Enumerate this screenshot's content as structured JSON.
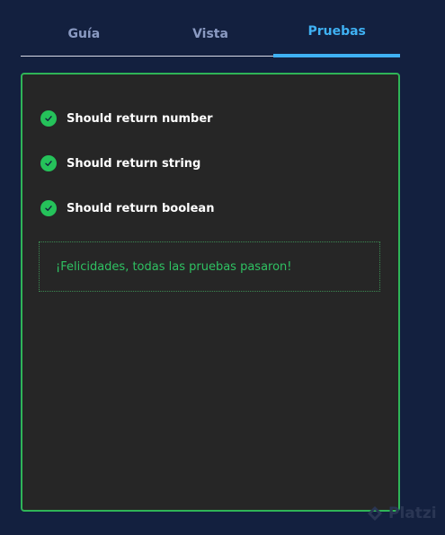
{
  "tabs": [
    {
      "label": "Guía",
      "active": false
    },
    {
      "label": "Vista",
      "active": false
    },
    {
      "label": "Pruebas",
      "active": true
    }
  ],
  "tests": [
    {
      "label": "Should return number",
      "status": "passed"
    },
    {
      "label": "Should return string",
      "status": "passed"
    },
    {
      "label": "Should return boolean",
      "status": "passed"
    }
  ],
  "result_message": "¡Felicidades, todas las pruebas pasaron!",
  "watermark": "Platzi",
  "colors": {
    "background": "#13203f",
    "panel": "#262626",
    "success": "#25c25a",
    "active_tab": "#3fb1f3",
    "inactive_tab": "#8a9ac2"
  }
}
